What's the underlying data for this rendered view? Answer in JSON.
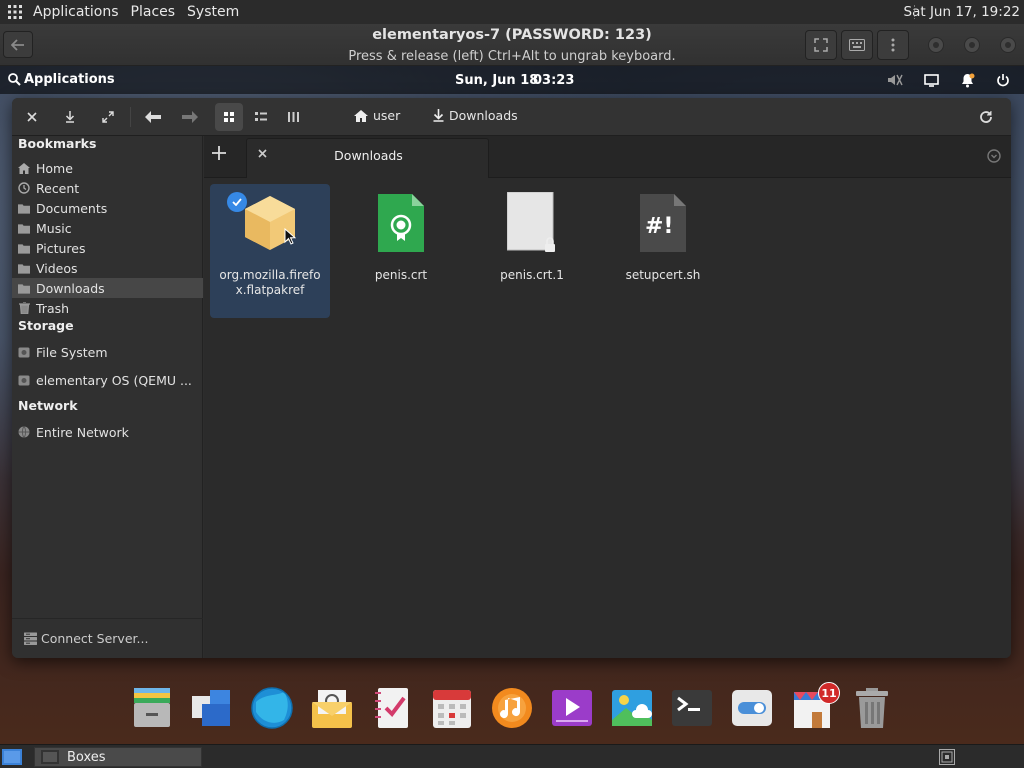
{
  "host_panel": {
    "menus": [
      "Applications",
      "Places",
      "System"
    ],
    "clock": "Sat Jun 17, 19:22"
  },
  "boxes": {
    "title": "elementaryos-7 (PASSWORD: 123)",
    "subtitle": "Press & release (left) Ctrl+Alt to ungrab keyboard."
  },
  "guest_panel": {
    "applications": "Applications",
    "date": "Sun, Jun 18",
    "time": "03:23"
  },
  "files": {
    "breadcrumb": [
      "user",
      "Downloads"
    ],
    "tab_label": "Downloads",
    "sidebar": {
      "bookmarks_header": "Bookmarks",
      "bookmarks": [
        "Home",
        "Recent",
        "Documents",
        "Music",
        "Pictures",
        "Videos",
        "Downloads",
        "Trash"
      ],
      "storage_header": "Storage",
      "storage": [
        "File System",
        "elementary OS (QEMU ..."
      ],
      "network_header": "Network",
      "network": [
        "Entire Network"
      ],
      "connect_server": "Connect Server..."
    },
    "items": [
      {
        "name": "org.mozilla.firefox.flatpakref",
        "icon": "package-icon",
        "selected": true
      },
      {
        "name": "penis.crt",
        "icon": "certificate-icon",
        "selected": false
      },
      {
        "name": "penis.crt.1",
        "icon": "blank-file-icon",
        "selected": false
      },
      {
        "name": "setupcert.sh",
        "icon": "script-icon",
        "selected": false
      }
    ]
  },
  "dock": {
    "apps": [
      "files",
      "multitasking-view",
      "web-browser",
      "mail",
      "tasks",
      "calendar",
      "music",
      "videos",
      "photos",
      "terminal",
      "system-settings",
      "appcenter",
      "trash"
    ],
    "appcenter_badge": "11"
  },
  "taskbar": {
    "task_label": "Boxes"
  },
  "colors": {
    "accent": "#3689e6",
    "selection": "#2d4059",
    "badge": "#d12a2a"
  }
}
